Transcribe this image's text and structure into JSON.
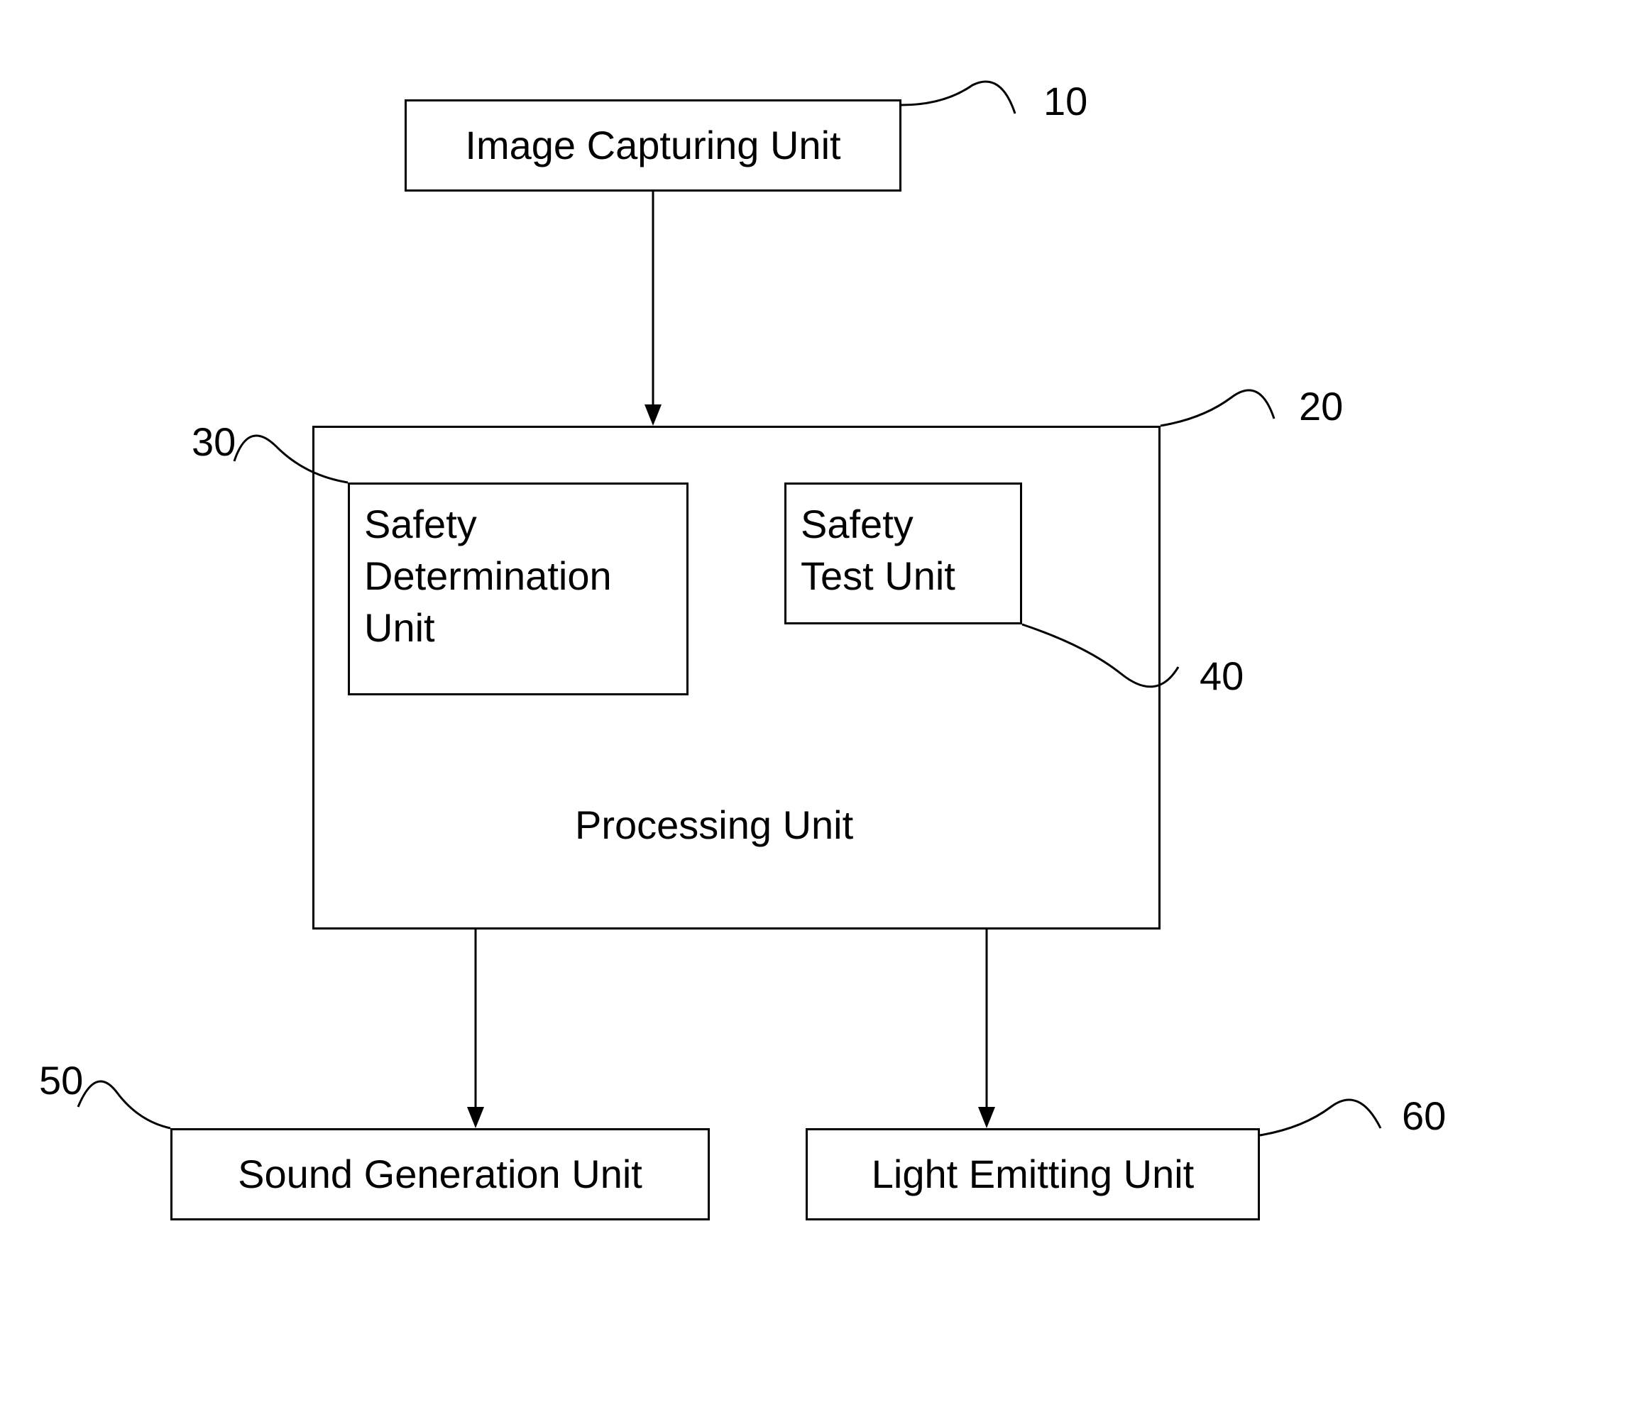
{
  "boxes": {
    "image_capturing": {
      "label": "Image Capturing Unit",
      "ref": "10"
    },
    "processing": {
      "label": "Processing Unit",
      "ref": "20"
    },
    "safety_determination": {
      "label": "Safety\nDetermination\nUnit",
      "ref": "30"
    },
    "safety_test": {
      "label": "Safety\nTest Unit",
      "ref": "40"
    },
    "sound_generation": {
      "label": "Sound Generation Unit",
      "ref": "50"
    },
    "light_emitting": {
      "label": "Light Emitting Unit",
      "ref": "60"
    }
  }
}
